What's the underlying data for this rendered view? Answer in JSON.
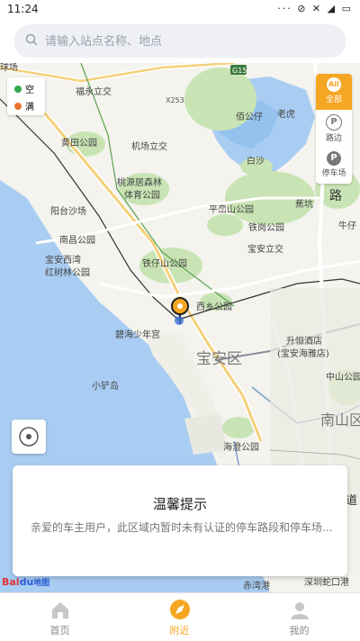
{
  "status_bar": {
    "time": "11:24",
    "icons": "··· ⊘ ✕ ◢ ▭"
  },
  "search": {
    "placeholder": "请输入站点名称、地点"
  },
  "legend": {
    "items": [
      {
        "label": "空",
        "color": "#2fa84f"
      },
      {
        "label": "满",
        "color": "#e8732e"
      }
    ]
  },
  "filters": {
    "all": "All",
    "all_label": "全部",
    "roadside": "路边",
    "parking_lot": "停车场",
    "p_glyph": "P"
  },
  "map": {
    "labels": {
      "fuyong": "福永立交",
      "huangtian_park": "黄田公园",
      "jichang_interchange": "机场立交",
      "taoyuanju": "桃源居森林",
      "taoyuanju2": "体育公园",
      "yangtai_beach": "阳台沙场",
      "nanchang_park": "南昌公园",
      "baoan_xiwan": "宝安西湾",
      "hongshulin": "红树林公园",
      "tiezaishan": "铁仔山公园",
      "xixiang": "西乡公园",
      "bihai": "碧海少年宫",
      "baoan_district": "宝安区",
      "xiaochan_island": "小铲岛",
      "hotel": "升恒酒店",
      "hotel2": "(宝安海雅店)",
      "zhongshan": "中山公园",
      "nanshan": "南山区",
      "haiyun": "海澄公园",
      "chiwan": "赤湾港",
      "shekou": "深圳蛇口港",
      "pingluanshan": "平峦山公园",
      "tiegang": "铁岗公园",
      "baoan_interchange": "宝安立交",
      "baiwei": "佰公仔",
      "laohu": "老虎",
      "baisha": "白沙",
      "jiaokeng": "蕉坑",
      "lu": "路",
      "niuzai": "牛仔",
      "dao": "道",
      "g15": "G15",
      "x253": "X253",
      "qiuchang": "球场"
    }
  },
  "notice": {
    "title": "温馨提示",
    "message": "亲爱的车主用户，此区域内暂时未有认证的停车路段和停车场..."
  },
  "baidu_logo": {
    "bai": "Bai",
    "du": "du",
    "map": "地图"
  },
  "tabs": [
    {
      "label": "首页",
      "icon": "home-icon",
      "active": false
    },
    {
      "label": "附近",
      "icon": "compass-icon",
      "active": true
    },
    {
      "label": "我的",
      "icon": "user-icon",
      "active": false
    }
  ],
  "colors": {
    "accent": "#f5a623",
    "water": "#a9cdf2",
    "land": "#f4f3ee",
    "green": "#c9e4b4"
  }
}
